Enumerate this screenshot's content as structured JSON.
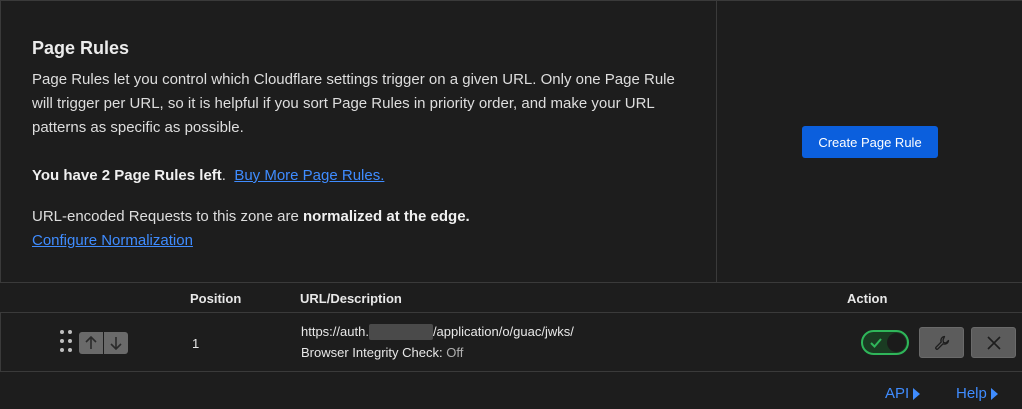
{
  "page_rules": {
    "title": "Page Rules",
    "description": "Page Rules let you control which Cloudflare settings trigger on a given URL. Only one Page Rule will trigger per URL, so it is helpful if you sort Page Rules in priority order, and make your URL patterns as specific as possible.",
    "quota_bold": "You have 2 Page Rules left",
    "quota_suffix": ".",
    "buy_more_link": "Buy More Page Rules.",
    "normalization_prefix": "URL-encoded Requests to this zone are ",
    "normalization_bold": "normalized at the edge.",
    "configure_link": "Configure Normalization",
    "create_button": "Create Page Rule"
  },
  "table": {
    "headers": {
      "position": "Position",
      "url": "URL/Description",
      "action": "Action"
    },
    "rows": [
      {
        "position": "1",
        "url_prefix": "https://auth.",
        "url_suffix": "/application/o/guac/jwks/",
        "setting_label": "Browser Integrity Check:",
        "setting_value": "Off",
        "enabled": true
      }
    ]
  },
  "footer": {
    "api_link": "API",
    "help_link": "Help"
  },
  "colors": {
    "accent": "#3f8cff",
    "primary_button": "#0b5fdd",
    "toggle_on": "#2fb65a"
  },
  "icons": [
    "drag-handle-icon",
    "arrow-up-icon",
    "arrow-down-icon",
    "check-icon",
    "wrench-icon",
    "close-icon",
    "caret-right-icon"
  ]
}
